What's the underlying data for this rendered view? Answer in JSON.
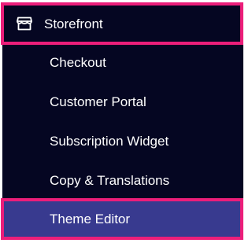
{
  "colors": {
    "panel_bg": "#050622",
    "highlight_border": "#ec1e7a",
    "selected_bg": "#383a8f",
    "text": "#ffffff"
  },
  "header": {
    "icon": "storefront-icon",
    "label": "Storefront"
  },
  "items": [
    {
      "label": "Checkout"
    },
    {
      "label": "Customer Portal"
    },
    {
      "label": "Subscription Widget"
    },
    {
      "label": "Copy & Translations"
    },
    {
      "label": "Theme Editor",
      "selected": true
    }
  ]
}
